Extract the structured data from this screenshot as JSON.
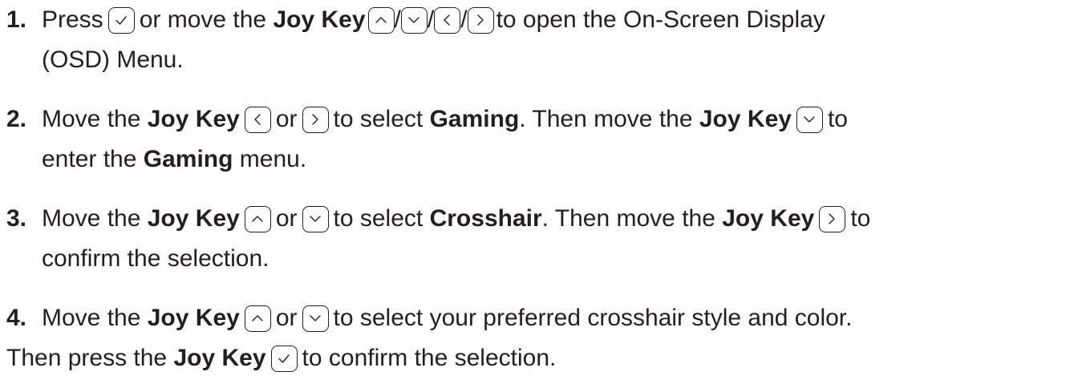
{
  "steps": [
    {
      "number": "1.",
      "t1": "Press",
      "t2": "or move the",
      "b1": "Joy Key",
      "sep": "/",
      "t3": "to open the On-Screen Display",
      "line2": "(OSD) Menu."
    },
    {
      "number": "2.",
      "t1": "Move the",
      "b1": "Joy Key",
      "t2": "or",
      "t3": "to select",
      "b2": "Gaming",
      "t4": ". Then move the",
      "b3": "Joy Key",
      "t5": "to",
      "line2a": "enter the",
      "line2b": "Gaming",
      "line2c": "menu."
    },
    {
      "number": "3.",
      "t1": "Move the",
      "b1": "Joy Key",
      "t2": "or",
      "t3": "to select",
      "b2": "Crosshair",
      "t4": ". Then move the",
      "b3": "Joy Key",
      "t5": "to",
      "line2": "confirm the selection."
    },
    {
      "number": "4.",
      "t1": "Move the",
      "b1": "Joy Key",
      "t2": "or",
      "t3": "to select your preferred crosshair style and color.",
      "line2a": "Then press the",
      "line2b": "Joy Key",
      "line2c": "to confirm the selection."
    }
  ],
  "icons": {
    "check": "checkmark-key-icon",
    "up": "up-arrow-key-icon",
    "down": "down-arrow-key-icon",
    "left": "left-arrow-key-icon",
    "right": "right-arrow-key-icon"
  },
  "colors": {
    "text": "#231f20",
    "background": "#ffffff"
  }
}
